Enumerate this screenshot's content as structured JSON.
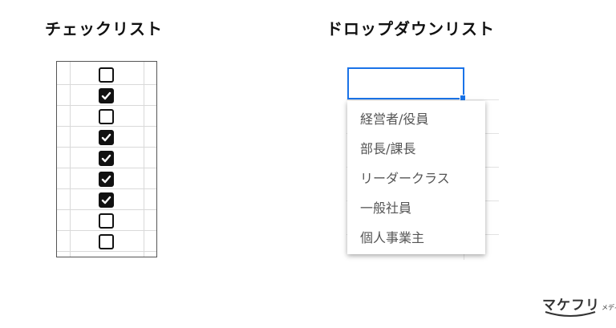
{
  "headings": {
    "checklist": "チェックリスト",
    "dropdown": "ドロップダウンリスト"
  },
  "checklist": {
    "items": [
      {
        "checked": false
      },
      {
        "checked": true
      },
      {
        "checked": false
      },
      {
        "checked": true
      },
      {
        "checked": true
      },
      {
        "checked": true
      },
      {
        "checked": true
      },
      {
        "checked": false
      },
      {
        "checked": false
      }
    ]
  },
  "dropdown": {
    "selected_value": "",
    "options": [
      "経営者/役員",
      "部長/課長",
      "リーダークラス",
      "一般社員",
      "個人事業主"
    ]
  },
  "logo": {
    "main": "マケフリ",
    "sub": "メディア"
  },
  "colors": {
    "accent": "#1a73e8",
    "option_text": "#555555",
    "checkbox": "#111111"
  }
}
